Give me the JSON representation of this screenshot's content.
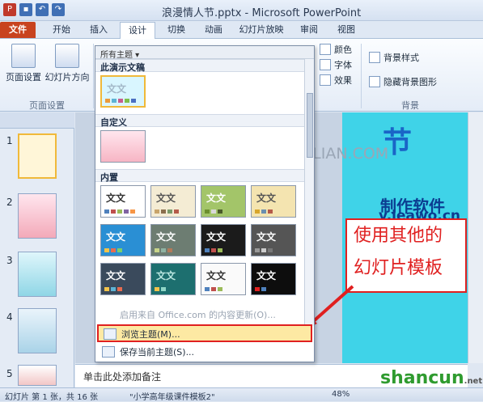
{
  "titlebar": {
    "title": "浪漫情人节.pptx - Microsoft PowerPoint"
  },
  "tabs": [
    {
      "label": "文件"
    },
    {
      "label": "开始"
    },
    {
      "label": "插入"
    },
    {
      "label": "设计"
    },
    {
      "label": "切换"
    },
    {
      "label": "动画"
    },
    {
      "label": "幻灯片放映"
    },
    {
      "label": "审阅"
    },
    {
      "label": "视图"
    }
  ],
  "ribbon": {
    "page_setup": "页面设置",
    "orientation": "幻灯片方向",
    "page_setup_group": "页面设置",
    "colors": "颜色",
    "fonts": "字体",
    "effects": "效果",
    "bg_styles": "背景样式",
    "hide_bg": "隐藏背景图形",
    "bg_group": "背景"
  },
  "dropdown": {
    "header": "所有主题",
    "sec_current": "此演示文稿",
    "sec_custom": "自定义",
    "sec_builtin": "内置",
    "theme_label": "文文",
    "office_update": "启用来自 Office.com 的内容更新(O)...",
    "browse": "浏览主题(M)...",
    "save": "保存当前主题(S)..."
  },
  "slide": {
    "big_char": "节",
    "line1": "制作软件",
    "line2": "v.leawo.cn",
    "watermark": "三联 3LIAN.COM"
  },
  "annotation": {
    "line1": "使用其他的",
    "line2": "幻灯片模板"
  },
  "thumbs": [
    {
      "num": "1"
    },
    {
      "num": "2"
    },
    {
      "num": "3"
    },
    {
      "num": "4"
    },
    {
      "num": "5"
    }
  ],
  "notes": {
    "placeholder": "单击此处添加备注"
  },
  "status": {
    "slide_info": "幻灯片 第 1 张，共 16 张",
    "template": "\"小学高年级课件模板2\"",
    "zoom": "48%"
  },
  "brand": {
    "name": "shancun",
    "suffix": ".net"
  }
}
